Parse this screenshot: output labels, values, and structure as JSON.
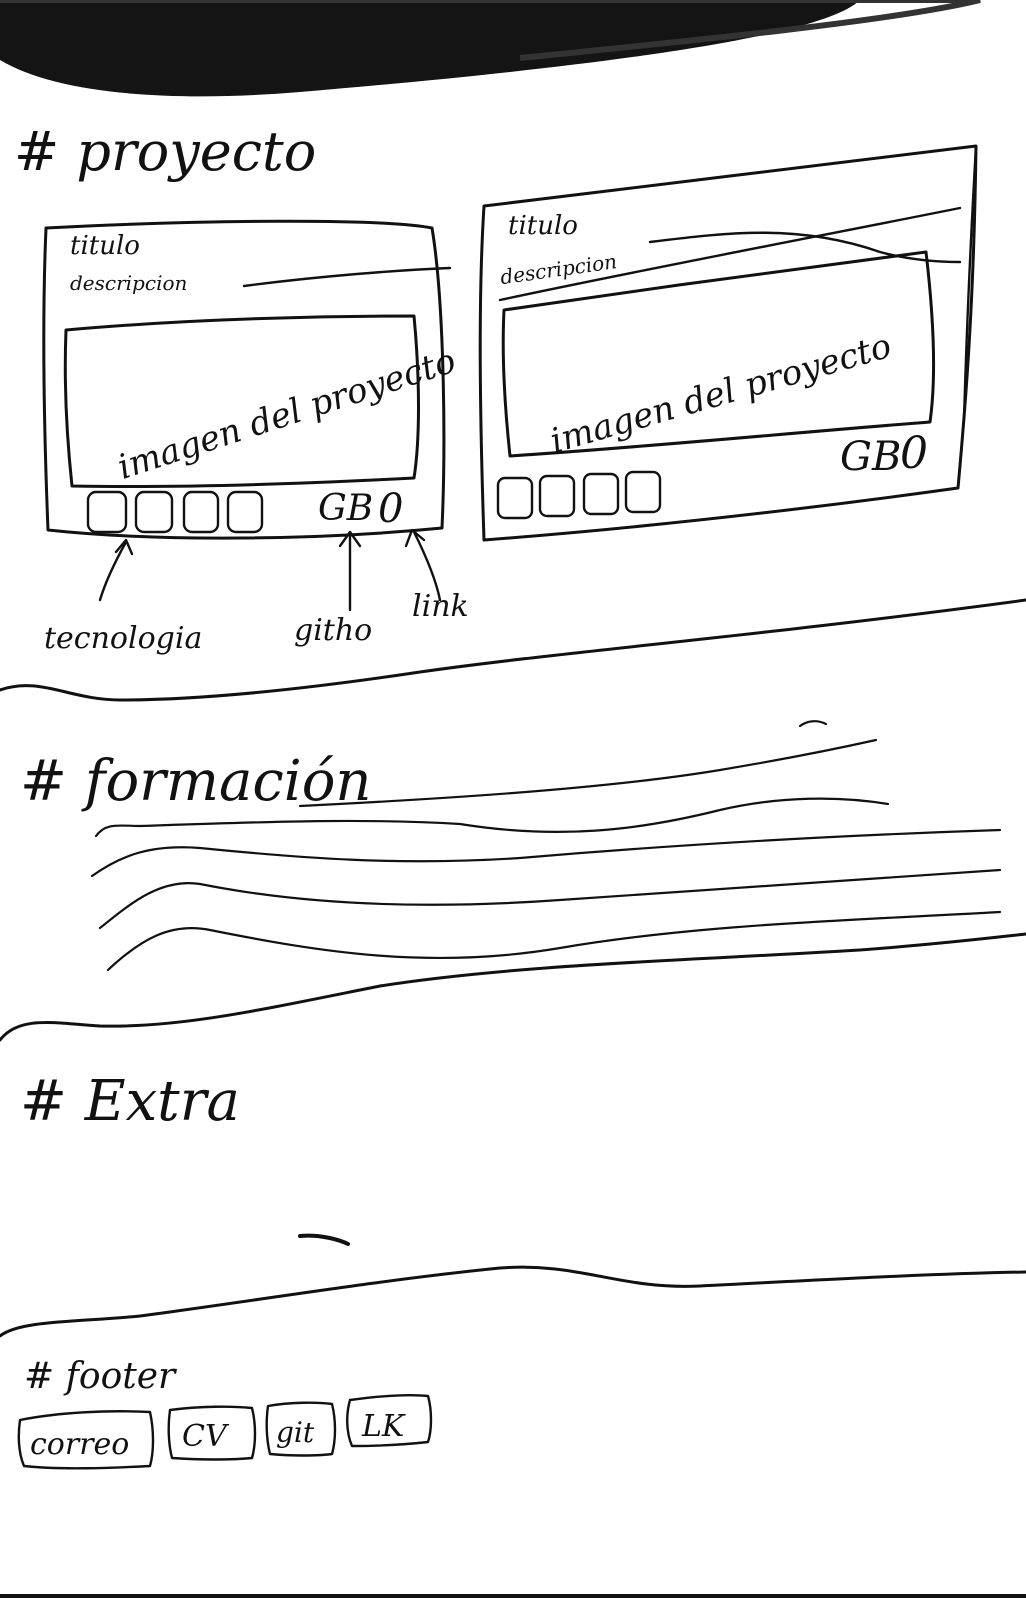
{
  "sections": {
    "proyecto": {
      "heading": "# proyecto",
      "cards": [
        {
          "title": "titulo",
          "description": "descripcion",
          "image_label": "imagen del proyecto"
        },
        {
          "title": "titulo",
          "description": "descripcion",
          "image_label": "imagen del proyecto"
        }
      ],
      "annotations": {
        "tecnologias": "tecnologia",
        "github": "githo",
        "link": "link"
      },
      "github_icon_text": "GB",
      "link_icon_text": "0"
    },
    "formacion": {
      "heading": "# formación"
    },
    "extra": {
      "heading": "# Extra"
    },
    "footer": {
      "heading": "# footer",
      "buttons": [
        "correo",
        "CV",
        "git",
        "LK"
      ]
    }
  },
  "colors": {
    "ink": "#111111",
    "paper": "#ffffff",
    "shadow": "#141414"
  }
}
